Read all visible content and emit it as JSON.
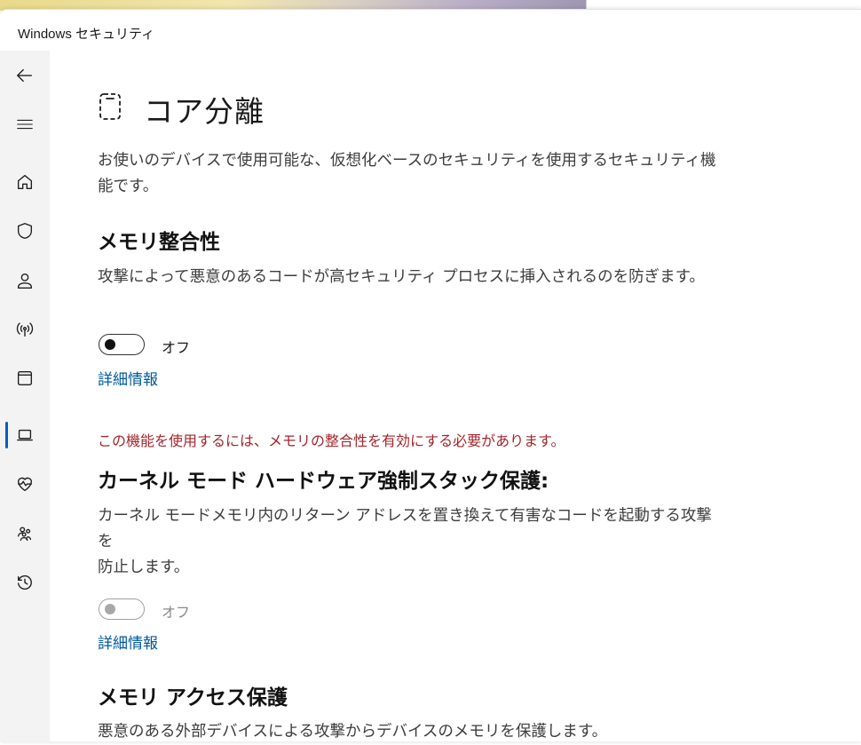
{
  "window": {
    "title": "Windows セキュリティ"
  },
  "sidebar": {
    "items": [
      {
        "icon": "back-arrow-icon"
      },
      {
        "icon": "hamburger-menu-icon"
      },
      {
        "icon": "home-icon"
      },
      {
        "icon": "shield-icon"
      },
      {
        "icon": "account-person-icon"
      },
      {
        "icon": "wifi-antenna-icon"
      },
      {
        "icon": "app-browser-window-icon"
      },
      {
        "icon": "laptop-device-icon",
        "active": true
      },
      {
        "icon": "heart-health-icon"
      },
      {
        "icon": "family-icon"
      },
      {
        "icon": "history-clock-icon"
      }
    ]
  },
  "page": {
    "title": "コア分離",
    "description": "お使いのデバイスで使用可能な、仮想化ベースのセキュリティを使用するセキュリティ機能です。",
    "description_lines": [
      "お使いのデバイスで使用可能な、仮想化ベースのセキュリティを使用するセキュリティ機",
      "能です。"
    ]
  },
  "memory_integrity": {
    "title": "メモリ整合性",
    "description": "攻撃によって悪意のあるコードが高セキュリティ プロセスに挿入されるのを防ぎます。",
    "toggle_label": "オフ",
    "toggle_on": false,
    "link": "詳細情報"
  },
  "warning_text": "この機能を使用するには、メモリの整合性を有効にする必要があります。",
  "kernel_stack": {
    "title": "カーネル モード ハードウェア強制スタック保護:",
    "description_lines": [
      "カーネル モードメモリ内のリターン アドレスを置き換えて有害なコードを起動する攻撃を",
      "防止します。"
    ],
    "toggle_label": "オフ",
    "toggle_on": false,
    "toggle_disabled": true,
    "link": "詳細情報"
  },
  "memory_access": {
    "title": "メモリ アクセス保護",
    "description": "悪意のある外部デバイスによる攻撃からデバイスのメモリを保護します。"
  },
  "colors": {
    "accent": "#005fb8",
    "link": "#005a9e",
    "warning": "#a4262c",
    "sidebar_bg": "#f3f3f3"
  }
}
